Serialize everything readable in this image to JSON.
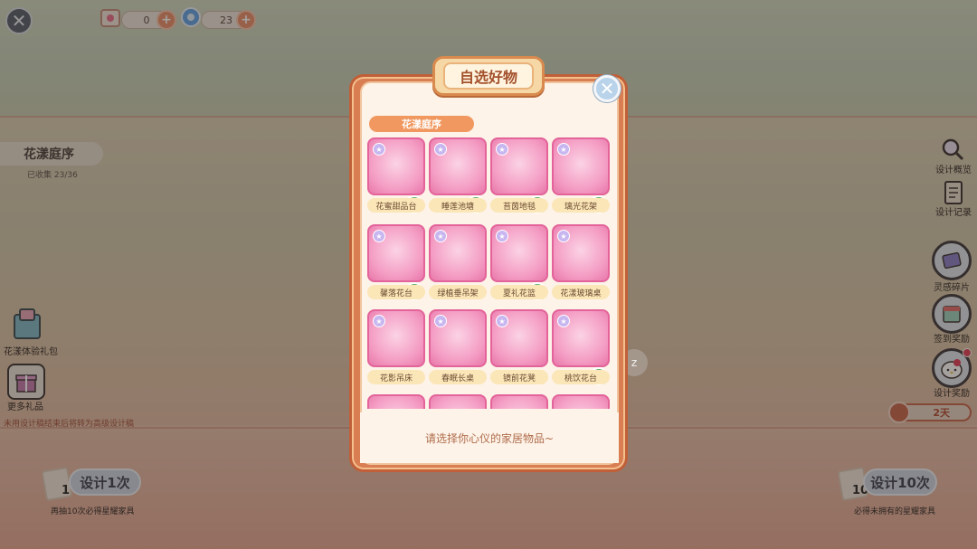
{
  "topbar": {
    "currency1": {
      "icon": "ticket-icon",
      "value": "0"
    },
    "currency2": {
      "icon": "swirl-gem-icon",
      "value": "23"
    }
  },
  "left_panel": {
    "collection_title": "花漾庭序",
    "collection_progress": "已收集 23/36",
    "gift_pack_label": "花漾体验礼包",
    "more_gifts_label": "更多礼品",
    "note": "未用设计稿结束后将转为高级设计稿",
    "design_once_label": "设计1次",
    "design_once_count": "1",
    "design_once_note": "再抽10次必得星耀家具"
  },
  "right_panel": {
    "overview_label": "设计概览",
    "record_label": "设计记录",
    "inspiration_label": "灵感碎片",
    "signin_label": "签到奖励",
    "design_reward_label": "设计奖励",
    "timer": "2天",
    "design_ten_label": "设计10次",
    "design_ten_count": "10",
    "design_ten_note": "必得未拥有的星耀家具"
  },
  "modal": {
    "title": "自选好物",
    "section": "花漾庭序",
    "hint": "请选择你心仪的家居物品~",
    "items": [
      {
        "label": "花蜜甜品台",
        "checked": true
      },
      {
        "label": "睡莲池塘",
        "checked": true
      },
      {
        "label": "苔茵地毯",
        "checked": true
      },
      {
        "label": "璃光花架",
        "checked": true
      },
      {
        "label": "馨落花台",
        "checked": true
      },
      {
        "label": "绿植垂吊架",
        "checked": false
      },
      {
        "label": "夏礼花篮",
        "checked": true
      },
      {
        "label": "花漾玻璃桌",
        "checked": false
      },
      {
        "label": "花影吊床",
        "checked": false
      },
      {
        "label": "春眠长桌",
        "checked": false
      },
      {
        "label": "镜前花凳",
        "checked": false
      },
      {
        "label": "桃饮花台",
        "checked": true
      }
    ]
  },
  "colors": {
    "modal_frame": "#d97d52",
    "tile_pink": "#f49cc3",
    "check_green": "#63b06a",
    "section_orange": "#f0985f"
  }
}
